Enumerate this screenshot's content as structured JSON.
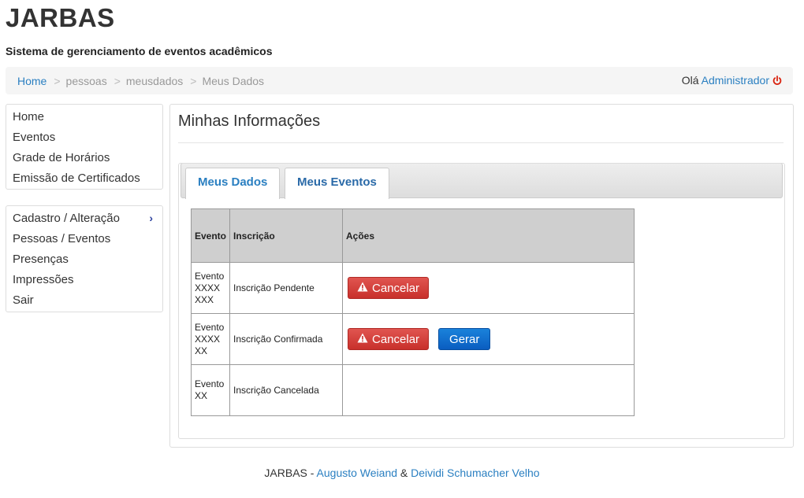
{
  "app": {
    "title": "JARBAS",
    "subtitle": "Sistema de gerenciamento de eventos acadêmicos"
  },
  "breadcrumb": {
    "items": [
      "Home",
      "pessoas",
      "meusdados",
      "Meus Dados"
    ],
    "separator": ">"
  },
  "user": {
    "greeting": "Olá",
    "name": "Administrador",
    "logout_icon": "power-icon"
  },
  "menu": {
    "group1": [
      "Home",
      "Eventos",
      "Grade de Horários",
      "Emissão de Certificados"
    ],
    "group2": [
      "Cadastro / Alteração",
      "Pessoas / Eventos",
      "Presenças",
      "Impressões",
      "Sair"
    ]
  },
  "main": {
    "title": "Minhas Informações",
    "tabs": [
      "Meus Dados",
      "Meus Eventos"
    ],
    "active_tab": "Meus Eventos",
    "table": {
      "headers": [
        "Evento",
        "Inscrição",
        "Ações"
      ],
      "rows": [
        {
          "evento": [
            "Evento",
            "XXXX",
            "XXX"
          ],
          "inscricao": "Inscrição Pendente",
          "actions": [
            "Cancelar"
          ]
        },
        {
          "evento": [
            "Evento",
            "XXXX",
            "XX"
          ],
          "inscricao": "Inscrição Confirmada",
          "actions": [
            "Cancelar",
            "Gerar"
          ]
        },
        {
          "evento": [
            "Evento",
            "XX"
          ],
          "inscricao": "Inscrição Cancelada",
          "actions": []
        }
      ]
    }
  },
  "footer": {
    "app": "JARBAS",
    "dash": " - ",
    "author1": "Augusto Weiand",
    "amp": " & ",
    "author2": "Deividi Schumacher Velho"
  },
  "colors": {
    "link": "#2a7fc1",
    "danger": "#c8302b",
    "primary": "#0a5dc0",
    "power": "#d9230f"
  }
}
